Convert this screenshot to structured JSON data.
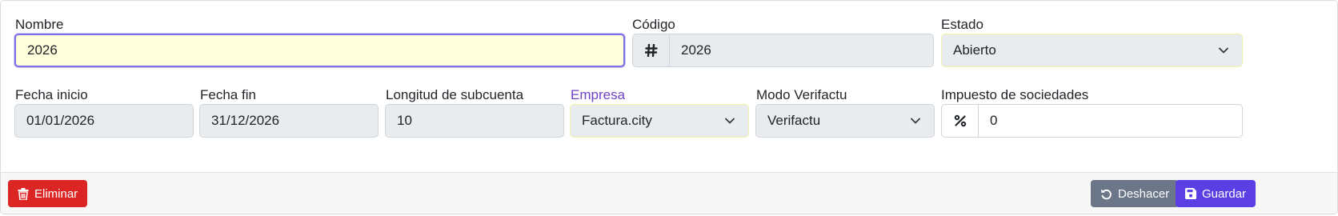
{
  "fields": {
    "nombre": {
      "label": "Nombre",
      "value": "2026"
    },
    "codigo": {
      "label": "Código",
      "prefix": "#",
      "value": "2026"
    },
    "estado": {
      "label": "Estado",
      "value": "Abierto"
    },
    "fecha_inicio": {
      "label": "Fecha inicio",
      "value": "01/01/2026"
    },
    "fecha_fin": {
      "label": "Fecha fin",
      "value": "31/12/2026"
    },
    "longitud_subcuenta": {
      "label": "Longitud de subcuenta",
      "value": "10"
    },
    "empresa": {
      "label": "Empresa",
      "value": "Factura.city"
    },
    "modo_verifactu": {
      "label": "Modo Verifactu",
      "value": "Verifactu"
    },
    "impuesto_sociedades": {
      "label": "Impuesto de sociedades",
      "prefix": "%",
      "value": "0"
    }
  },
  "footer": {
    "delete_label": "Eliminar",
    "undo_label": "Deshacer",
    "save_label": "Guardar"
  },
  "colors": {
    "danger": "#dc2626",
    "secondary": "#6c7689",
    "primary": "#5b3fe4",
    "accent_label": "#6f42c1",
    "required_bg": "#ffffdb"
  },
  "icons": {
    "codigo_prefix": "hash-icon",
    "impuesto_prefix": "percent-icon",
    "select": "chevron-down-icon",
    "delete": "trash-icon",
    "undo": "undo-icon",
    "save": "floppy-disk-icon"
  }
}
